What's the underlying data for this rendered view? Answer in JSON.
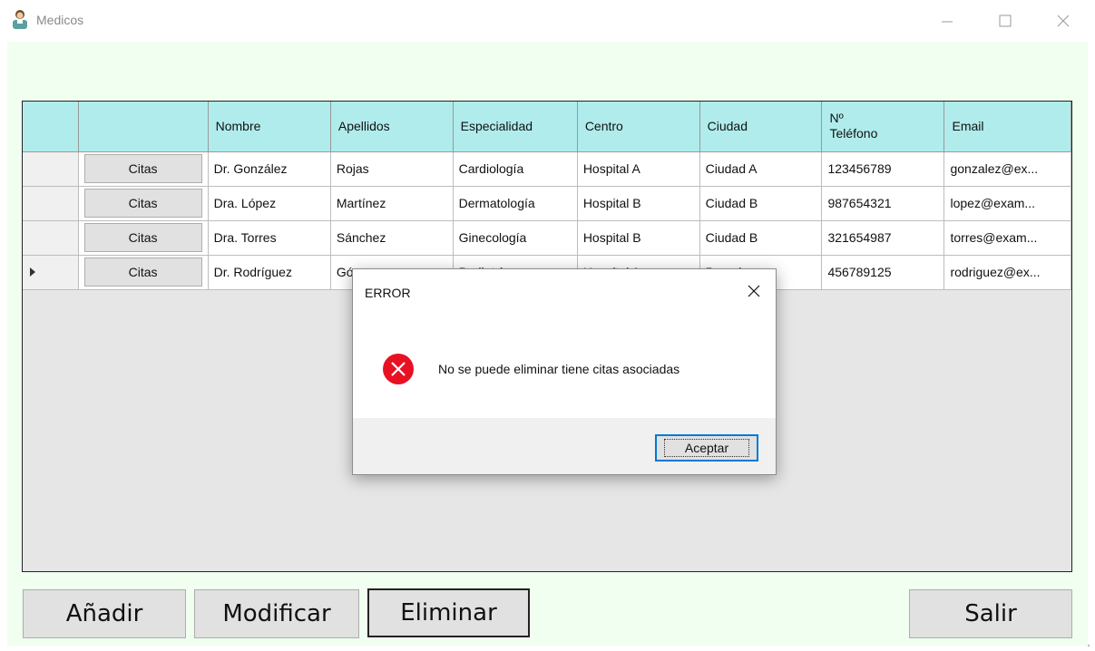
{
  "window": {
    "title": "Medicos",
    "icon": "doctor-icon",
    "controls": {
      "minimize": "minimize-icon",
      "maximize": "maximize-icon",
      "close": "close-icon"
    }
  },
  "grid": {
    "columns": [
      "",
      "",
      "Nombre",
      "Apellidos",
      "Especialidad",
      "Centro",
      "Ciudad",
      "Nº Teléfono",
      "Email"
    ],
    "rows": [
      {
        "button": "Citas",
        "nombre": "Dr. González",
        "apellidos": "Rojas",
        "especialidad": "Cardiología",
        "centro": "Hospital A",
        "ciudad": "Ciudad A",
        "telefono": "123456789",
        "email": "gonzalez@ex..."
      },
      {
        "button": "Citas",
        "nombre": "Dra. López",
        "apellidos": "Martínez",
        "especialidad": "Dermatología",
        "centro": "Hospital B",
        "ciudad": "Ciudad B",
        "telefono": "987654321",
        "email": "lopez@exam..."
      },
      {
        "button": "Citas",
        "nombre": "Dra. Torres",
        "apellidos": "Sánchez",
        "especialidad": "Ginecología",
        "centro": "Hospital B",
        "ciudad": "Ciudad B",
        "telefono": "321654987",
        "email": "torres@exam..."
      },
      {
        "button": "Citas",
        "nombre": "Dr. Rodríguez",
        "apellidos": "Gómez",
        "especialidad": "Pediatría",
        "centro": "Hospital A",
        "ciudad": "Pamplona",
        "telefono": "456789125",
        "email": "rodriguez@ex..."
      }
    ]
  },
  "buttons": {
    "add": "Añadir",
    "modify": "Modificar",
    "delete": "Eliminar",
    "exit": "Salir"
  },
  "dialog": {
    "title": "ERROR",
    "message": "No se puede eliminar tiene citas asociadas",
    "ok": "Aceptar",
    "icon": "error-icon"
  },
  "colors": {
    "background": "#f0fff0",
    "header": "#b0ecec",
    "selection": "#0078d7",
    "error": "#e81123"
  }
}
